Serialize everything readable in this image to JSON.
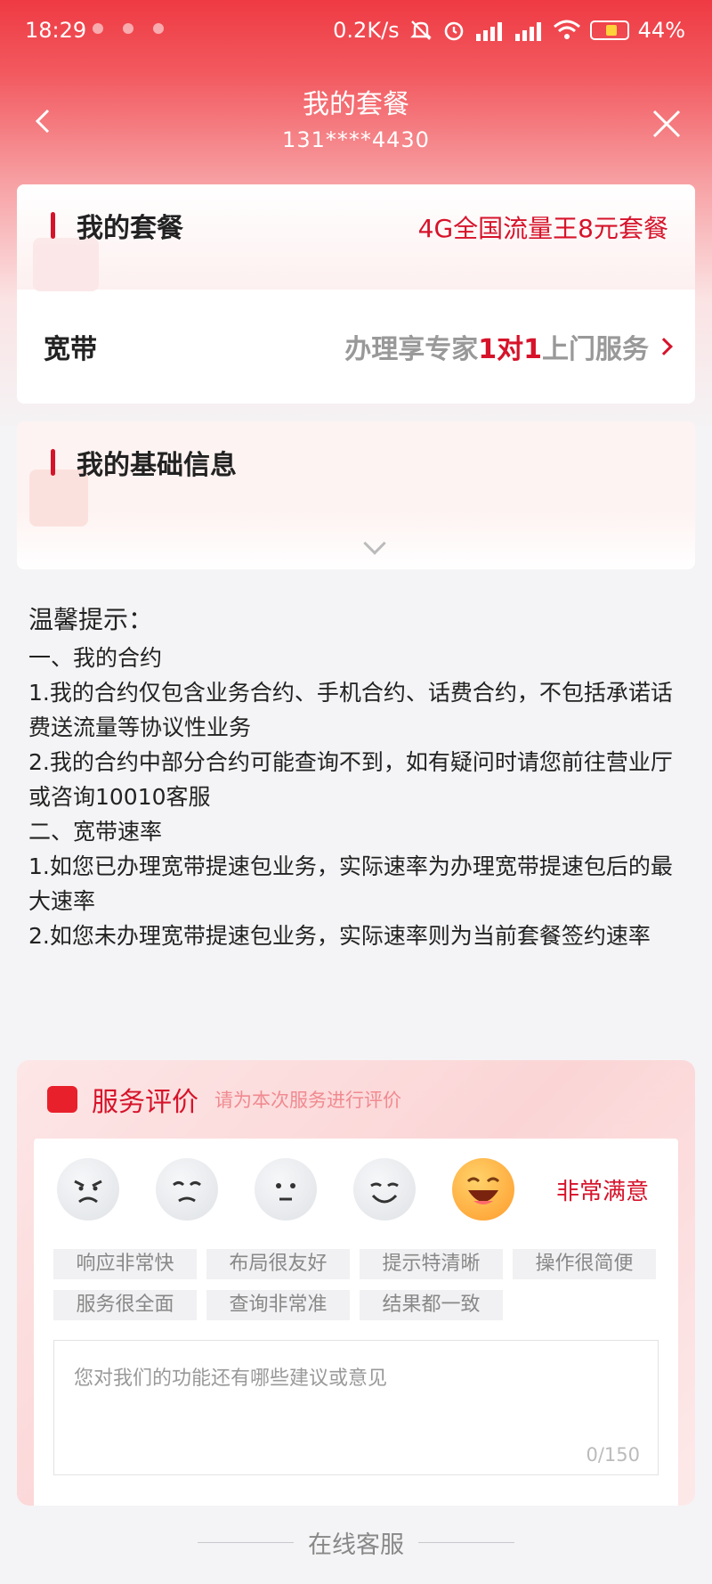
{
  "status_bar": {
    "time": "18:29",
    "speed": "0.2K/s",
    "battery": "44%"
  },
  "nav": {
    "title": "我的套餐",
    "phone": "131****4430",
    "back_icon": "chevron-left-icon",
    "close_icon": "close-icon"
  },
  "plan_card": {
    "title": "我的套餐",
    "plan_name": "4G全国流量王8元套餐",
    "broadband_label": "宽带",
    "broadband_promo_prefix": "办理享专家",
    "broadband_promo_highlight": "1对1",
    "broadband_promo_suffix": "上门服务"
  },
  "basic_info": {
    "title": "我的基础信息"
  },
  "tips": {
    "title": "温馨提示：",
    "lines": [
      "一、我的合约",
      "1.我的合约仅包含业务合约、手机合约、话费合约，不包括承诺话费送流量等协议性业务",
      "2.我的合约中部分合约可能查询不到，如有疑问时请您前往营业厅或咨询10010客服",
      "二、宽带速率",
      "1.如您已办理宽带提速包业务，实际速率为办理宽带提速包后的最大速率",
      "2.如您未办理宽带提速包业务，实际速率则为当前套餐签约速率"
    ]
  },
  "rating": {
    "title": "服务评价",
    "hint": "请为本次服务进行评价",
    "selected_label": "非常满意",
    "tags": [
      "响应非常快",
      "布局很友好",
      "提示特清晰",
      "操作很简便",
      "服务很全面",
      "查询非常准",
      "结果都一致"
    ],
    "feedback_placeholder": "您对我们的功能还有哪些建议或意见",
    "counter": "0/150"
  },
  "footer": {
    "customer_service": "在线客服"
  },
  "colors": {
    "brand_red": "#d6132a",
    "header_red": "#ef3a43"
  }
}
